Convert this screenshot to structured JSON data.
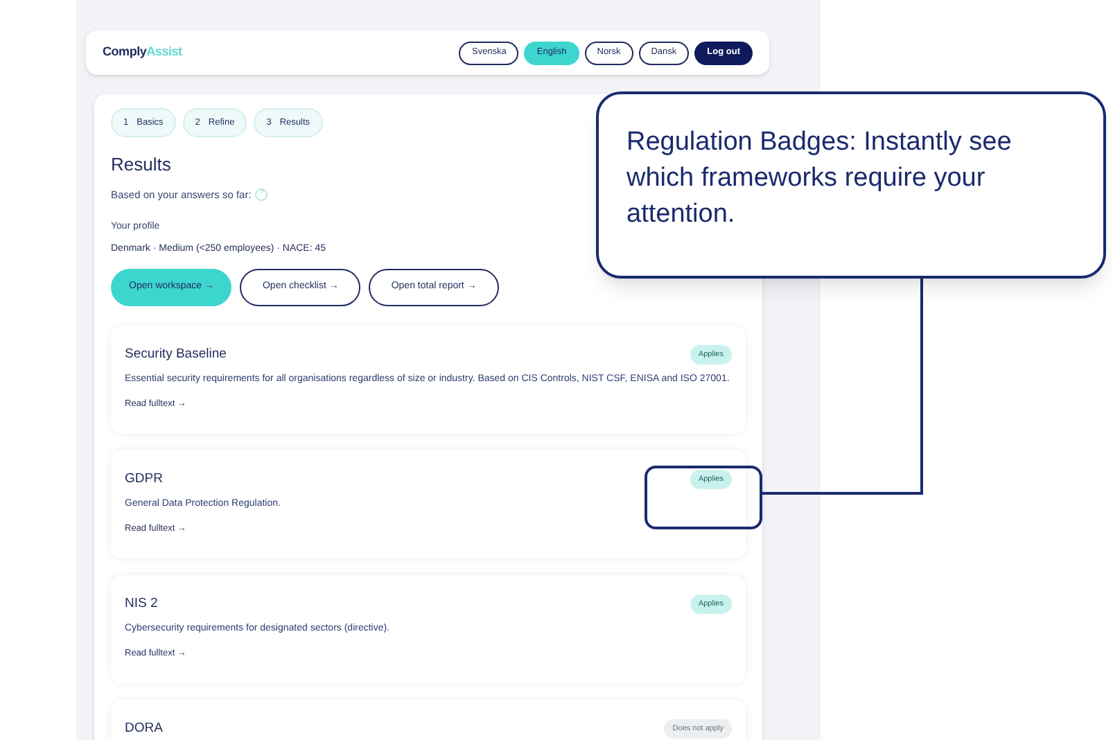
{
  "brand": {
    "part_1": "Comply",
    "part_2": "Assist"
  },
  "languages": [
    {
      "label": "Svenska",
      "selected": false
    },
    {
      "label": "English",
      "selected": true
    },
    {
      "label": "Norsk",
      "selected": false
    },
    {
      "label": "Dansk",
      "selected": false
    }
  ],
  "logout": "Log out",
  "steps": [
    {
      "number": "1",
      "label": "Basics"
    },
    {
      "number": "2",
      "label": "Refine"
    },
    {
      "number": "3",
      "label": "Results"
    }
  ],
  "title": "Results",
  "subtitle": "Based on your answers so far:",
  "help": "?",
  "profile_label": "Your profile",
  "profile_value": "Denmark · Medium (<250 employees) · NACE: 45",
  "actions": [
    {
      "label": "Open workspace →",
      "kind": "primary"
    },
    {
      "label": "Open checklist →",
      "kind": "outline"
    },
    {
      "label": "Open total report →",
      "kind": "outline"
    }
  ],
  "regulations": [
    {
      "name": "Security Baseline",
      "description": "Essential security requirements for all organisations regardless of size or industry. Based on CIS Controls, NIST CSF, ENISA and ISO 27001.",
      "link": "Read fulltext →",
      "badge": "Applies",
      "applies": true
    },
    {
      "name": "GDPR",
      "description": "General Data Protection Regulation.",
      "link": "Read fulltext →",
      "badge": "Applies",
      "applies": true
    },
    {
      "name": "NIS 2",
      "description": "Cybersecurity requirements for designated sectors (directive).",
      "link": "Read fulltext →",
      "badge": "Applies",
      "applies": true
    },
    {
      "name": "DORA",
      "badge": "Does not apply",
      "applies": false
    }
  ],
  "callout": {
    "text": "Regulation Badges: Instantly see which frameworks require your attention."
  }
}
